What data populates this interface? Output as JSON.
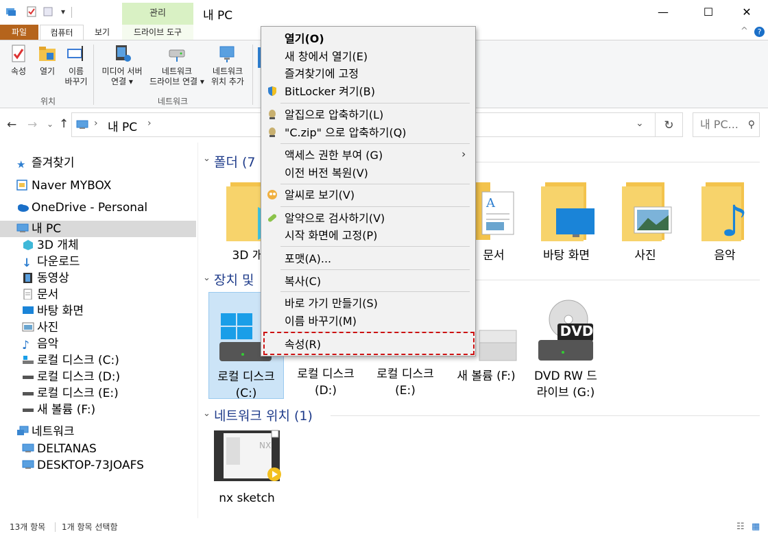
{
  "window": {
    "title": "내 PC",
    "manage_tab": "관리",
    "minimize": "—",
    "maximize": "☐",
    "close": "✕"
  },
  "tabs": {
    "file": "파일",
    "computer": "컴퓨터",
    "view": "보기",
    "drive_tools": "드라이브 도구"
  },
  "ribbon": {
    "properties": "속성",
    "open": "열기",
    "rename_1": "이름",
    "rename_2": "바꾸기",
    "location_group": "위치",
    "media_1": "미디어 서버",
    "media_2": "연결 ▾",
    "netdrive_1": "네트워크",
    "netdrive_2": "드라이브 연결 ▾",
    "netloc_1": "네트워크",
    "netloc_2": "위치 추가",
    "network_group": "네트워크"
  },
  "address": {
    "path_root": "내 PC",
    "search_placeholder": "내 PC..."
  },
  "sidebar": {
    "favorites": "즐겨찾기",
    "mybox": "Naver MYBOX",
    "onedrive": "OneDrive - Personal",
    "thispc": "내 PC",
    "objects3d": "3D 개체",
    "downloads": "다운로드",
    "videos": "동영상",
    "documents": "문서",
    "desktop": "바탕 화면",
    "pictures": "사진",
    "music": "음악",
    "disk_c": "로컬 디스크 (C:)",
    "disk_d": "로컬 디스크 (D:)",
    "disk_e": "로컬 디스크 (E:)",
    "vol_f": "새 볼륨 (F:)",
    "network": "네트워크",
    "deltanas": "DELTANAS",
    "desktop73": "DESKTOP-73JOAFS"
  },
  "content": {
    "folders_title": "폴더 (7",
    "devices_title": "장치 및",
    "network_title": "네트워크 위치 (1)",
    "folder_3d": "3D 개",
    "folder_docs": "문서",
    "folder_desktop": "바탕 화면",
    "folder_pictures": "사진",
    "folder_music": "음악",
    "drive_c_1": "로컬 디스크",
    "drive_c_2": "(C:)",
    "drive_d_1": "로컬 디스크",
    "drive_d_2": "(D:)",
    "drive_e_1": "로컬 디스크",
    "drive_e_2": "(E:)",
    "drive_f": "새 볼륨 (F:)",
    "dvd_1": "DVD RW 드",
    "dvd_2": "라이브 (G:)",
    "dvd_badge": "DVD",
    "nx_sketch": "nx sketch"
  },
  "context_menu": {
    "open": "열기(O)",
    "open_new": "새 창에서 열기(E)",
    "pin_fav": "즐겨찾기에 고정",
    "bitlocker": "BitLocker 켜기(B)",
    "alzip": "알집으로 압축하기(L)",
    "czip": "\"C.zip\" 으로 압축하기(Q)",
    "access": "액세스 권한 부여 (G)",
    "restore": "이전 버전 복원(V)",
    "alsee": "알씨로 보기(V)",
    "alyac": "알약으로 검사하기(V)",
    "pin_start": "시작 화면에 고정(P)",
    "format": "포맷(A)...",
    "copy": "복사(C)",
    "shortcut": "바로 가기 만들기(S)",
    "rename": "이름 바꾸기(M)",
    "properties": "속성(R)"
  },
  "status": {
    "count": "13개 항목",
    "selected": "1개 항목 선택함"
  }
}
